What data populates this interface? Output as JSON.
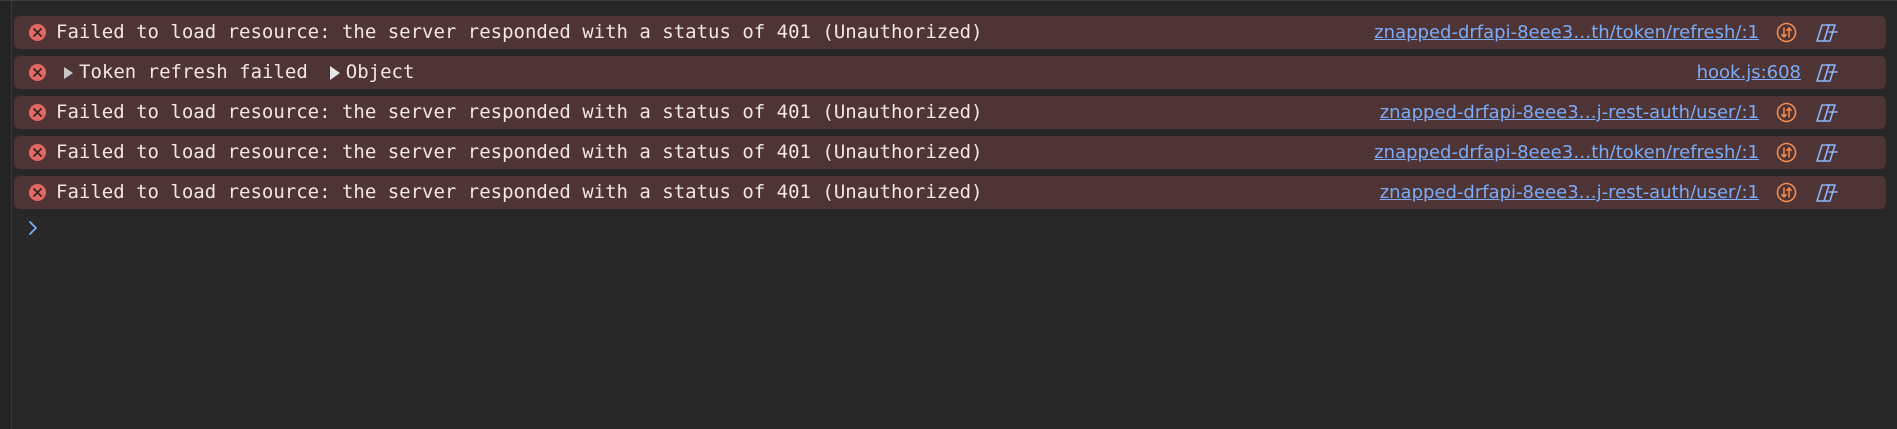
{
  "console": {
    "messages": [
      {
        "type": "error",
        "text": "Failed to load resource: the server responded with a status of 401 (Unauthorized)",
        "source": "znapped-drfapi-8eee3…th/token/refresh/:1",
        "has_network_icon": true
      },
      {
        "type": "error",
        "label": "Token refresh failed",
        "object_label": "Object",
        "source": "hook.js:608",
        "has_network_icon": false
      },
      {
        "type": "error",
        "text": "Failed to load resource: the server responded with a status of 401 (Unauthorized)",
        "source": "znapped-drfapi-8eee3…j-rest-auth/user/:1",
        "has_network_icon": true
      },
      {
        "type": "error",
        "text": "Failed to load resource: the server responded with a status of 401 (Unauthorized)",
        "source": "znapped-drfapi-8eee3…th/token/refresh/:1",
        "has_network_icon": true
      },
      {
        "type": "error",
        "text": "Failed to load resource: the server responded with a status of 401 (Unauthorized)",
        "source": "znapped-drfapi-8eee3…j-rest-auth/user/:1",
        "has_network_icon": true
      }
    ]
  },
  "icons": {
    "error": "error-circle-x-icon",
    "network": "network-request-icon",
    "copilot": "copilot-icon",
    "prompt": "chevron-right-icon"
  },
  "colors": {
    "background": "#282828",
    "error_row_bg": "#4e3434",
    "error_icon": "#e46962",
    "message_text": "#f0e6e6",
    "link": "#7cacf8",
    "network_icon": "#f28b54",
    "copilot_icon": "#8ab4f8"
  }
}
